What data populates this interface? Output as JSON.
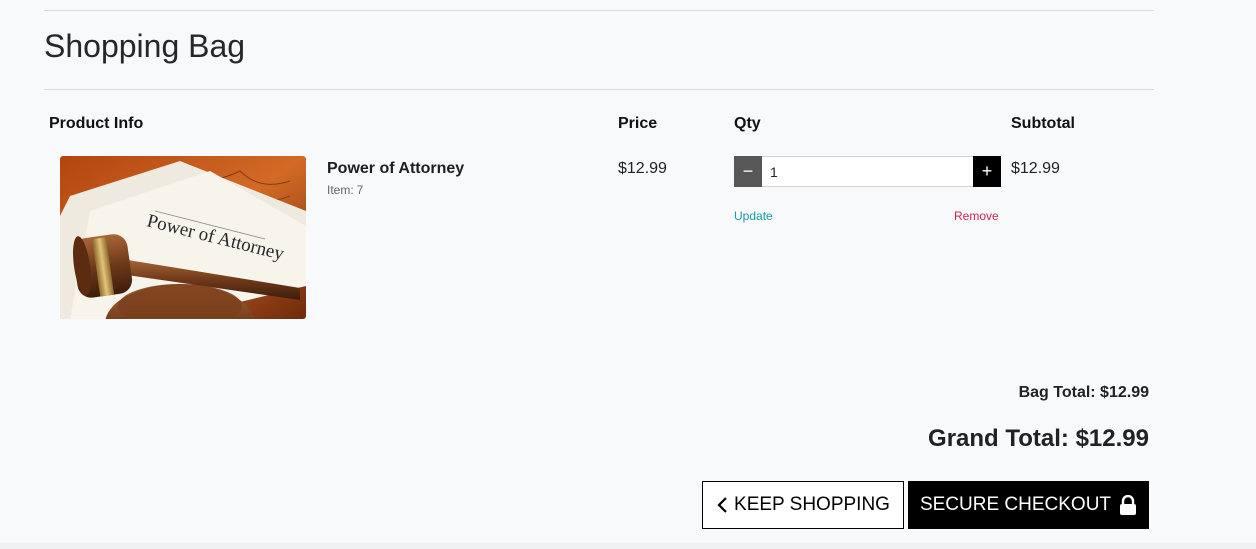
{
  "page": {
    "title": "Shopping Bag"
  },
  "table": {
    "headers": {
      "product_info": "Product Info",
      "price": "Price",
      "qty": "Qty",
      "subtotal": "Subtotal"
    }
  },
  "cart_item": {
    "name": "Power of Attorney",
    "item_label": "Item:",
    "item_number": "7",
    "image_text": "Power of Attorney",
    "price": "$12.99",
    "quantity": "1",
    "subtotal": "$12.99",
    "update_label": "Update",
    "remove_label": "Remove",
    "minus_symbol": "−",
    "plus_symbol": "+"
  },
  "totals": {
    "bag_total": "Bag Total: $12.99",
    "grand_total": "Grand Total: $12.99"
  },
  "actions": {
    "keep_shopping": "KEEP SHOPPING",
    "secure_checkout": "SECURE CHECKOUT"
  },
  "colors": {
    "update_link": "#179aa6",
    "remove_link": "#d1234a",
    "button_dark": "#000000"
  },
  "icons": {
    "back": "chevron-left-icon",
    "checkout": "lock-icon"
  }
}
